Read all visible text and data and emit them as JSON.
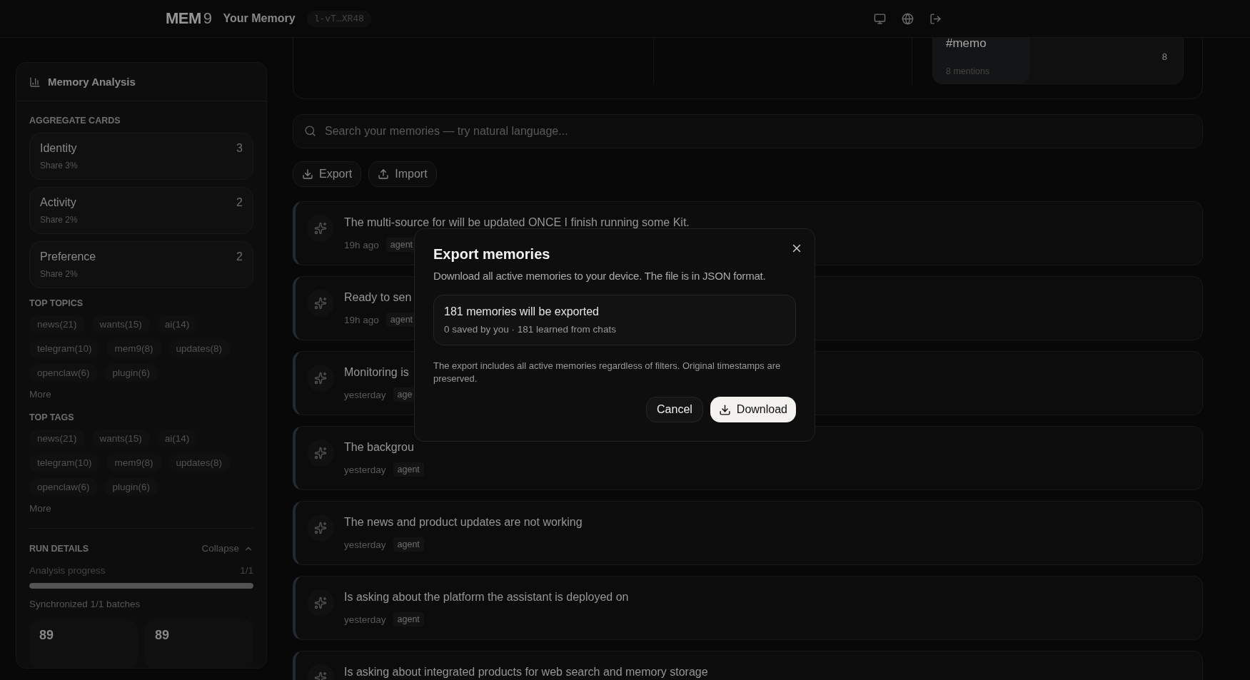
{
  "header": {
    "logo_text": "MEM",
    "logo_number": "9",
    "title": "Your Memory",
    "key": "l-vT…XR48"
  },
  "top_panel": {
    "card": {
      "title": "#memo",
      "subtitle": "8 mentions",
      "count": "8"
    }
  },
  "sidebar": {
    "title": "Memory Analysis",
    "aggregate_heading": "AGGREGATE CARDS",
    "aggregate_cards": [
      {
        "name": "Identity",
        "share": "Share 3%",
        "count": "3"
      },
      {
        "name": "Activity",
        "share": "Share 2%",
        "count": "2"
      },
      {
        "name": "Preference",
        "share": "Share 2%",
        "count": "2"
      }
    ],
    "topics": {
      "heading": "TOP TOPICS",
      "chips": [
        "news(21)",
        "wants(15)",
        "ai(14)",
        "telegram(10)",
        "mem9(8)",
        "updates(8)",
        "openclaw(6)",
        "plugin(6)"
      ],
      "more": "More"
    },
    "tags": {
      "heading": "TOP TAGS",
      "chips": [
        "news(21)",
        "wants(15)",
        "ai(14)",
        "telegram(10)",
        "mem9(8)",
        "updates(8)",
        "openclaw(6)",
        "plugin(6)"
      ],
      "more": "More"
    },
    "run": {
      "heading": "RUN DETAILS",
      "collapse": "Collapse",
      "progress_label": "Analysis progress",
      "progress_count": "1/1",
      "level": 1,
      "sync": "Synchronized 1/1 batches",
      "stats": [
        "89",
        "89"
      ]
    }
  },
  "search": {
    "placeholder": "Search your memories — try natural language..."
  },
  "actions": [
    {
      "label": "Export",
      "kind": "download"
    },
    {
      "label": "Import",
      "kind": "upload"
    }
  ],
  "memories": [
    {
      "text": "The multi-source for will be updated ONCE I finish running some Kit.",
      "time": "19h ago",
      "tag": "agent"
    },
    {
      "text": "Ready to sen",
      "time": "19h ago",
      "tag": "agent"
    },
    {
      "text": "Monitoring is",
      "time": "yesterday",
      "tag": "age"
    },
    {
      "text": "The backgrou",
      "time": "yesterday",
      "tag": "agent"
    },
    {
      "text": "The news and product updates are not working",
      "time": "yesterday",
      "tag": "agent"
    },
    {
      "text": "Is asking about the platform the assistant is deployed on",
      "time": "yesterday",
      "tag": "agent"
    },
    {
      "text": "Is asking about integrated products for web search and memory storage"
    }
  ],
  "dialog": {
    "title": "Export memories",
    "description": "Download all active memories to your device. The file is in JSON format.",
    "summary_title": "181 memories will be exported",
    "summary_detail": "0 saved by you · 181 learned from chats",
    "note": "The export includes all active memories regardless of filters. Original timestamps are preserved.",
    "cancel": "Cancel",
    "confirm": "Download"
  }
}
